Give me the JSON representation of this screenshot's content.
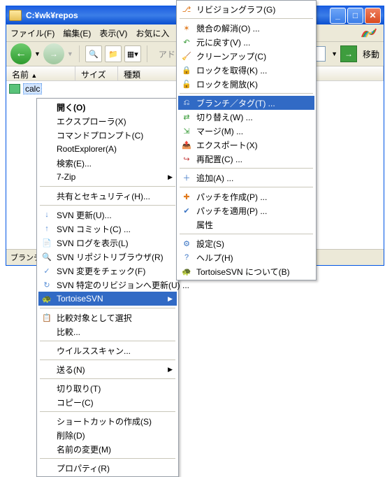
{
  "window": {
    "title": "C:¥wk¥repos"
  },
  "menubar": {
    "file": "ファイル(F)",
    "edit": "編集(E)",
    "view": "表示(V)",
    "favorites": "お気に入"
  },
  "toolbar": {
    "addr_label": "アド",
    "go_label": "移動"
  },
  "headers": {
    "name": "名前",
    "size": "サイズ",
    "type": "種類"
  },
  "files": {
    "item0": "calc"
  },
  "statusbar": {
    "text": "ブランチや"
  },
  "ctx_left": {
    "open": "開く(O)",
    "explorer": "エクスプローラ(X)",
    "cmd_prompt": "コマンドプロンプト(C)",
    "root_explorer": "RootExplorer(A)",
    "search": "検索(E)...",
    "sevenzip": "7-Zip",
    "share_sec": "共有とセキュリティ(H)...",
    "svn_update": "SVN 更新(U)...",
    "svn_commit": "SVN コミット(C) ...",
    "svn_showlog": "SVN ログを表示(L)",
    "svn_repobrowser": "SVN リポジトリブラウザ(R)",
    "svn_checkmod": "SVN 変更をチェック(F)",
    "svn_updaterev": "SVN 特定のリビジョンへ更新(U) ...",
    "tortoisesvn": "TortoiseSVN",
    "compare_select": "比較対象として選択",
    "compare": "比較...",
    "virus_scan": "ウイルススキャン...",
    "send_to": "送る(N)",
    "cut": "切り取り(T)",
    "copy": "コピー(C)",
    "create_shortcut": "ショートカットの作成(S)",
    "delete": "削除(D)",
    "rename": "名前の変更(M)",
    "properties": "プロパティ(R)"
  },
  "ctx_right": {
    "revision_graph": "リビジョングラフ(G)",
    "resolve": "競合の解消(O) ...",
    "revert": "元に戻す(V) ...",
    "cleanup": "クリーンアップ(C)",
    "get_lock": "ロックを取得(K) ...",
    "release_lock": "ロックを開放(K)",
    "branch_tag": "ブランチ／タグ(T) ...",
    "switch": "切り替え(W) ...",
    "merge": "マージ(M) ...",
    "export": "エクスポート(X)",
    "relocate": "再配置(C) ...",
    "add": "追加(A) ...",
    "create_patch": "パッチを作成(P) ...",
    "apply_patch": "パッチを適用(P) ...",
    "properties": "属性",
    "settings": "設定(S)",
    "help": "ヘルプ(H)",
    "about": "TortoiseSVN について(B)"
  }
}
